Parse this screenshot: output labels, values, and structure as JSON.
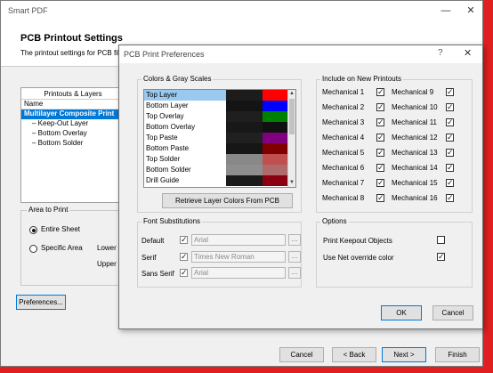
{
  "outer": {
    "title": "Smart PDF",
    "header_title": "PCB Printout Settings",
    "header_sub": "The printout settings for PCB file",
    "panel_header": "Printouts & Layers",
    "col_name": "Name",
    "tree": [
      {
        "label": "Multilayer Composite Print"
      },
      {
        "label": "Keep-Out Layer"
      },
      {
        "label": "Bottom Overlay"
      },
      {
        "label": "Bottom Solder"
      }
    ],
    "area_label": "Area to Print",
    "entire_sheet": "Entire Sheet",
    "specific_area": "Specific Area",
    "lower_left": "Lower L",
    "upper_right": "Upper R",
    "preferences_btn": "Preferences...",
    "cancel_btn": "Cancel",
    "back_btn": "< Back",
    "next_btn": "Next >",
    "finish_btn": "Finish"
  },
  "inner": {
    "title": "PCB Print Preferences",
    "help": "?",
    "close": "✕",
    "colors_label": "Colors & Gray Scales",
    "layers": [
      {
        "name": "Top Layer",
        "gray": "#1c1c1c",
        "color": "#ff0000"
      },
      {
        "name": "Bottom Layer",
        "gray": "#141414",
        "color": "#0000ff"
      },
      {
        "name": "Top Overlay",
        "gray": "#1f1f1f",
        "color": "#008000"
      },
      {
        "name": "Bottom Overlay",
        "gray": "#181818",
        "color": "#101010"
      },
      {
        "name": "Top Paste",
        "gray": "#202020",
        "color": "#800080"
      },
      {
        "name": "Bottom Paste",
        "gray": "#161616",
        "color": "#800000"
      },
      {
        "name": "Top Solder",
        "gray": "#888888",
        "color": "#c05050"
      },
      {
        "name": "Bottom Solder",
        "gray": "#8e8e8e",
        "color": "#b06a6a"
      },
      {
        "name": "Drill Guide",
        "gray": "#1a1a1a",
        "color": "#8a0010"
      }
    ],
    "retrieve_btn": "Retrieve Layer Colors From PCB",
    "include_label": "Include on New Printouts",
    "mechanical": [
      {
        "label": "Mechanical 1",
        "checked": true
      },
      {
        "label": "Mechanical 9",
        "checked": true
      },
      {
        "label": "Mechanical 2",
        "checked": true
      },
      {
        "label": "Mechanical 10",
        "checked": true
      },
      {
        "label": "Mechanical 3",
        "checked": true
      },
      {
        "label": "Mechanical 11",
        "checked": true
      },
      {
        "label": "Mechanical 4",
        "checked": true
      },
      {
        "label": "Mechanical 12",
        "checked": true
      },
      {
        "label": "Mechanical 5",
        "checked": true
      },
      {
        "label": "Mechanical 13",
        "checked": true
      },
      {
        "label": "Mechanical 6",
        "checked": true
      },
      {
        "label": "Mechanical 14",
        "checked": true
      },
      {
        "label": "Mechanical 7",
        "checked": true
      },
      {
        "label": "Mechanical 15",
        "checked": true
      },
      {
        "label": "Mechanical 8",
        "checked": true
      },
      {
        "label": "Mechanical 16",
        "checked": true
      }
    ],
    "fonts_label": "Font Substitutions",
    "font_default_label": "Default",
    "font_default_value": "Arial",
    "font_serif_label": "Serif",
    "font_serif_value": "Times New Roman",
    "font_sans_label": "Sans Serif",
    "font_sans_value": "Arial",
    "dots": "...",
    "options_label": "Options",
    "opt_keepout": "Print Keepout Objects",
    "opt_keepout_checked": false,
    "opt_netcolor": "Use Net override color",
    "opt_netcolor_checked": true,
    "ok_btn": "OK",
    "cancel_btn": "Cancel"
  }
}
